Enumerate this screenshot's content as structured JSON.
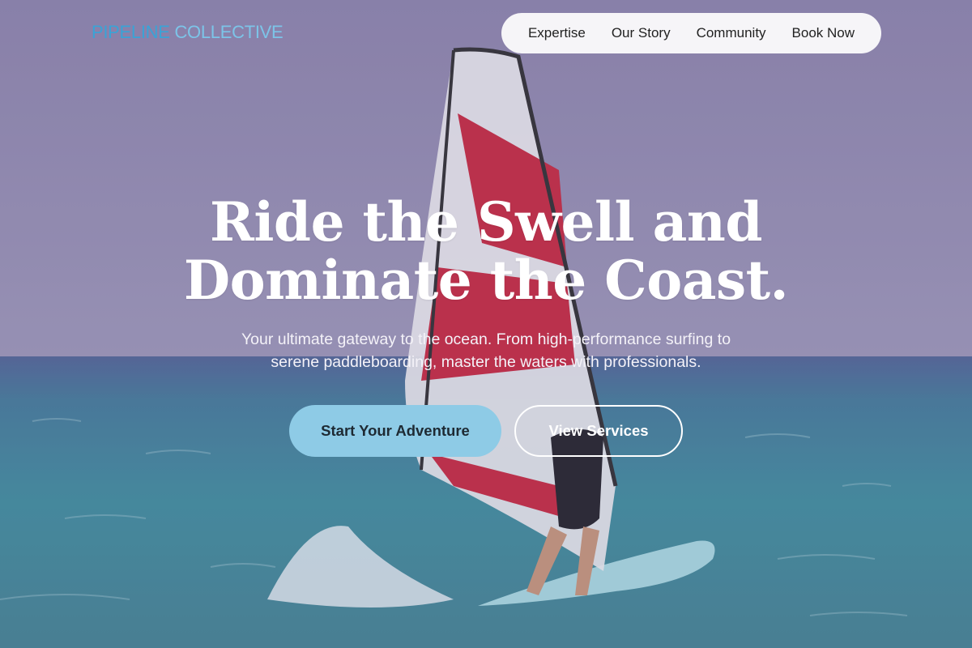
{
  "header": {
    "logo_part1": "PIPELINE",
    "logo_part2": "COLLECTIVE",
    "nav": [
      {
        "label": "Expertise"
      },
      {
        "label": "Our Story"
      },
      {
        "label": "Community"
      },
      {
        "label": "Book Now"
      }
    ]
  },
  "hero": {
    "headline_line1": "Ride the Swell and",
    "headline_line2": "Dominate the Coast.",
    "subtitle_line1": "Your ultimate gateway to the ocean. From high-performance surfing to",
    "subtitle_line2": "serene paddleboarding, master the waters with professionals.",
    "primary_button": "Start Your Adventure",
    "secondary_button": "View Services",
    "image": "windsurfer-photo"
  },
  "colors": {
    "logo_primary": "#3aa3d6",
    "logo_secondary": "#7cc4e8",
    "primary_button_bg": "#8ecbe6",
    "nav_pill_bg": "#ffffff",
    "headline": "#ffffff"
  }
}
